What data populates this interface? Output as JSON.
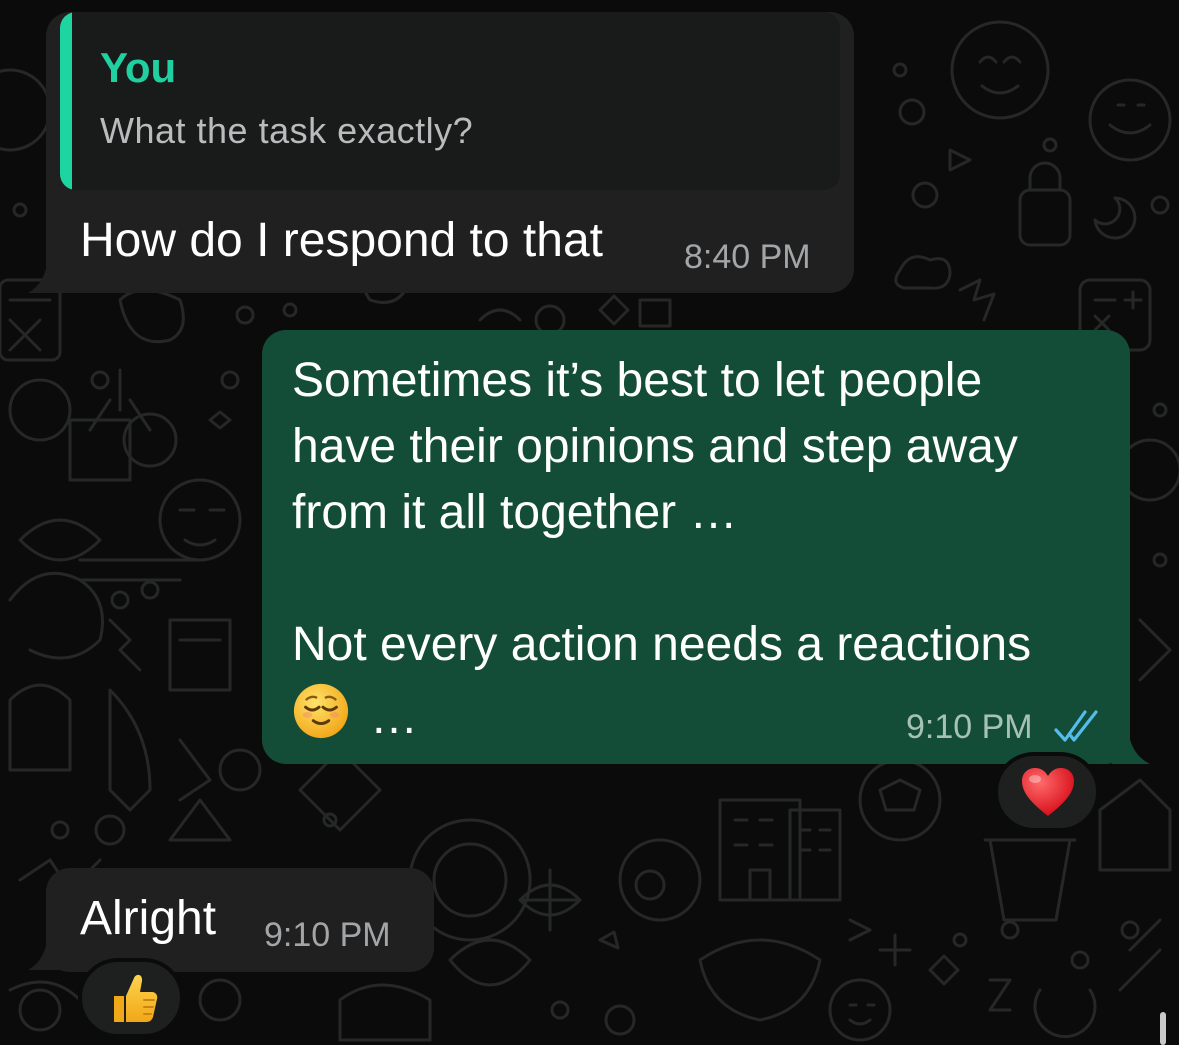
{
  "colors": {
    "background": "#0b0b0b",
    "incoming_bubble": "#202020",
    "outgoing_bubble": "#144d37",
    "quote_accent": "#1ed4a0",
    "read_ticks": "#53bdeb"
  },
  "messages": [
    {
      "direction": "incoming",
      "quote": {
        "author": "You",
        "text": "What the task exactly?"
      },
      "text": "How do I respond to that",
      "time": "8:40 PM"
    },
    {
      "direction": "outgoing",
      "text": "Sometimes it’s best to let people\nhave their opinions and step away\nfrom it all together …\n\nNot every action needs a reactions",
      "trailing_emoji": "relieved-face-emoji",
      "trailing_text": "…",
      "time": "9:10 PM",
      "status": "read",
      "reaction": "red-heart-emoji"
    },
    {
      "direction": "incoming",
      "text": "Alright",
      "time": "9:10 PM",
      "reaction": "thumbs-up-emoji"
    }
  ]
}
